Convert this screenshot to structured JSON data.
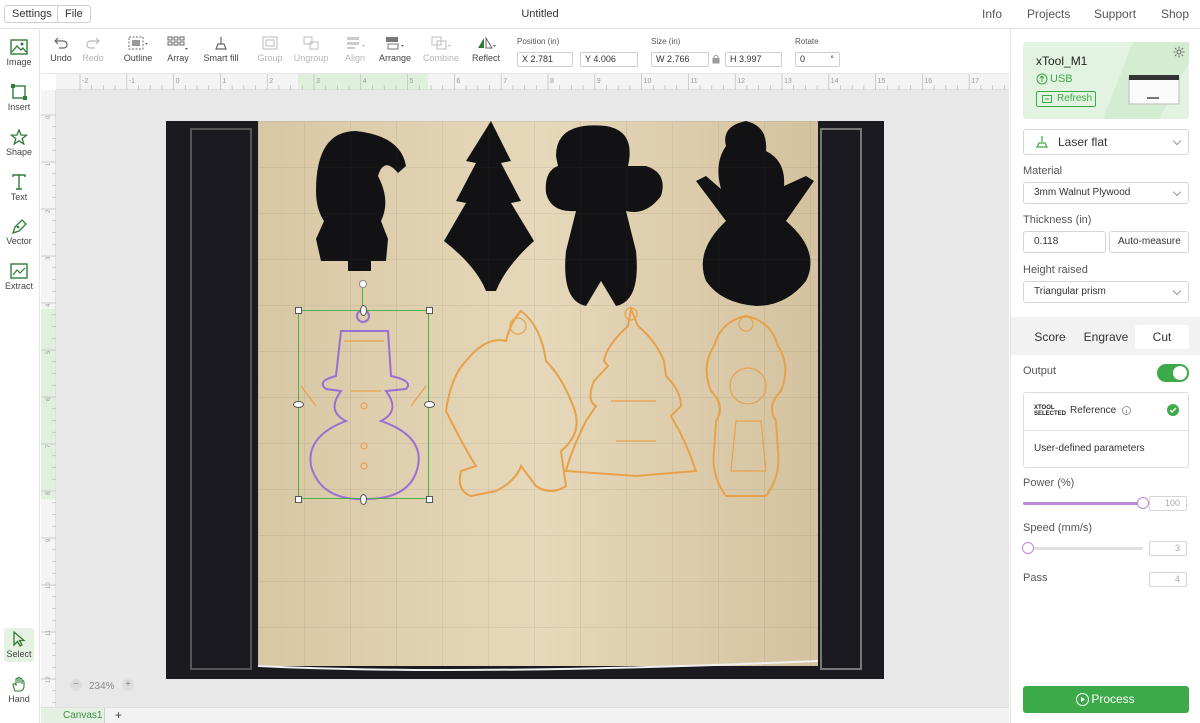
{
  "topbar": {
    "settings": "Settings",
    "file": "File",
    "title": "Untitled",
    "nav": [
      "Info",
      "Projects",
      "Support",
      "Shop"
    ]
  },
  "left_tools": [
    "Image",
    "Insert",
    "Shape",
    "Text",
    "Vector",
    "Extract"
  ],
  "bottom_tools": [
    "Select",
    "Hand"
  ],
  "toolbar": {
    "undo": "Undo",
    "redo": "Redo",
    "outline": "Outline",
    "array": "Array",
    "smart_fill": "Smart fill",
    "group": "Group",
    "ungroup": "Ungroup",
    "align": "Align",
    "arrange": "Arrange",
    "combine": "Combine",
    "reflect": "Reflect"
  },
  "position": {
    "label": "Position (in)",
    "x": "X 2.781",
    "y": "Y 4.006"
  },
  "size": {
    "label": "Size (in)",
    "w": "W 2.766",
    "h": "H 3.997"
  },
  "rotate": {
    "label": "Rotate",
    "value": "0",
    "unit": "°"
  },
  "ruler_h": [
    "-2",
    "-1",
    "0",
    "1",
    "2",
    "3",
    "4",
    "5",
    "6",
    "7",
    "8",
    "9",
    "10",
    "11",
    "12",
    "13",
    "14",
    "15",
    "16",
    "17"
  ],
  "ruler_v": [
    "0",
    "1",
    "2",
    "3",
    "4",
    "5",
    "6",
    "7",
    "8",
    "9",
    "10",
    "11",
    "12"
  ],
  "zoom": {
    "minus": "−",
    "level": "234%",
    "plus": "+"
  },
  "canvas_tab": {
    "name": "Canvas1",
    "add": "+"
  },
  "device": {
    "name": "xTool_M1",
    "connection": "USB",
    "refresh": "Refresh"
  },
  "panel": {
    "mode": "Laser flat",
    "material_label": "Material",
    "material": "3mm Walnut Plywood",
    "thickness_label": "Thickness (in)",
    "thickness": "0.118",
    "auto_measure": "Auto-measure",
    "height_label": "Height raised",
    "height": "Triangular prism",
    "tabs": [
      "Score",
      "Engrave",
      "Cut"
    ],
    "output_label": "Output",
    "xtool_badge_1": "XTOOL",
    "xtool_badge_2": "SELECTED",
    "reference": "Reference",
    "user_defined": "User-defined parameters",
    "power_label": "Power (%)",
    "power": "100",
    "power_fraction": 1.0,
    "speed_label": "Speed (mm/s)",
    "speed": "3",
    "speed_fraction": 0.0,
    "pass_label": "Pass",
    "pass": "4",
    "process": "Process"
  },
  "colors": {
    "accent": "#3daa49",
    "selection": "#4cae4c",
    "slider": "#b98ad6",
    "outline_orange": "#e7a14b",
    "outline_purple": "#9b6fd1"
  }
}
